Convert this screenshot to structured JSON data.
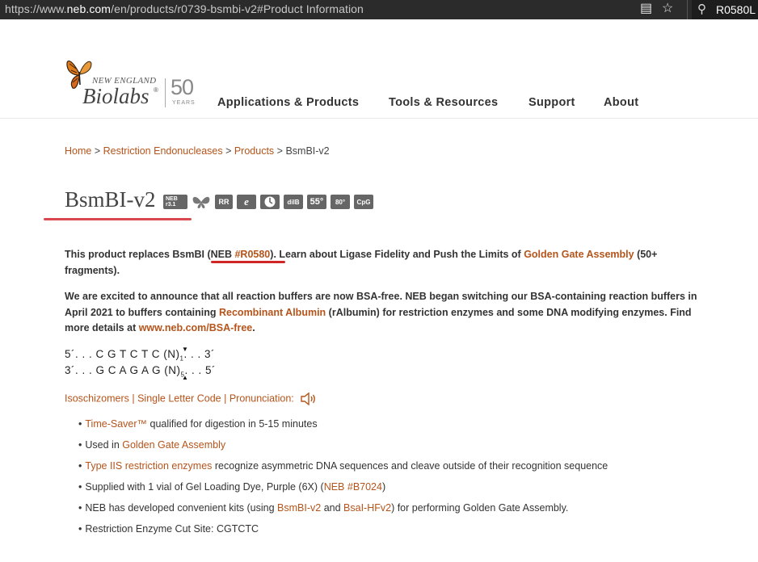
{
  "browser": {
    "url_prefix": "https://www.",
    "url_host": "neb.com",
    "url_path": "/en/products/r0739-bsmbi-v2#Product Information",
    "search_query": "R0580L"
  },
  "logo": {
    "line1": "NEW ENGLAND",
    "line2": "Biolabs",
    "reg": "®",
    "anniversary": "50",
    "years": "YEARS"
  },
  "nav": [
    "Applications & Products",
    "Tools & Resources",
    "Support",
    "About"
  ],
  "breadcrumb": {
    "home": "Home",
    "sep": " > ",
    "restriction": "Restriction Endonucleases",
    "products": "Products",
    "current": "BsmBI-v2"
  },
  "title": "BsmBI-v2",
  "badges": [
    "NEB r3.1",
    "butterfly",
    "RR",
    "e",
    "clock",
    "dilB",
    "55°",
    "80°",
    "CpG"
  ],
  "p1": {
    "a": "This product replaces BsmBI ",
    "b": "(NEB ",
    "c": "#R0580",
    "d": ")",
    "e": ". Learn about Ligase Fidelity and Push the Limits of ",
    "f": "Golden Gate Assembly",
    "g": " (50+ fragments)."
  },
  "p2": {
    "a": "We are excited to announce that all reaction buffers are now BSA-free. NEB began switching our BSA-containing reaction buffers in April 2021 to buffers containing ",
    "b": "Recombinant Albumin",
    "c": " (rAlbumin) for restriction enzymes and some DNA modifying enzymes. Find more details at ",
    "d": "www.neb.com/BSA-free",
    "e": "."
  },
  "sequence": {
    "top": "5´. . . C G T C T C (N)",
    "top_sub": "1",
    "top_end": ". . . 3´",
    "bottom": "3´. . . G C A G A G (N)",
    "bottom_sub": "5",
    "bottom_end": ". . . 5´"
  },
  "links_row": {
    "iso": "Isoschizomers",
    "sep": " | ",
    "single": "Single Letter Code",
    "pron": "Pronunciation:"
  },
  "bullets": {
    "b1_link": "Time-Saver™",
    "b1_text": " qualified for digestion in 5-15 minutes",
    "b2_text": "Used in ",
    "b2_link": "Golden Gate Assembly",
    "b3_link": "Type IIS restriction enzymes",
    "b3_text": " recognize asymmetric DNA sequences and cleave outside of their recognition sequence",
    "b4_text": "Supplied with 1 vial of Gel Loading Dye, Purple (6X) (",
    "b4_link": "NEB #B7024",
    "b4_end": ")",
    "b5_text": "NEB has developed convenient kits (using ",
    "b5_link1": "BsmBI-v2",
    "b5_mid": " and ",
    "b5_link2": "BsaI-HFv2",
    "b5_end": ") for performing Golden Gate Assembly.",
    "b6_text": "Restriction Enzyme Cut Site: CGTCTC"
  },
  "colors": {
    "link": "#b5541b",
    "underline_red": "#d12626",
    "title_underline": "#d9484f"
  }
}
